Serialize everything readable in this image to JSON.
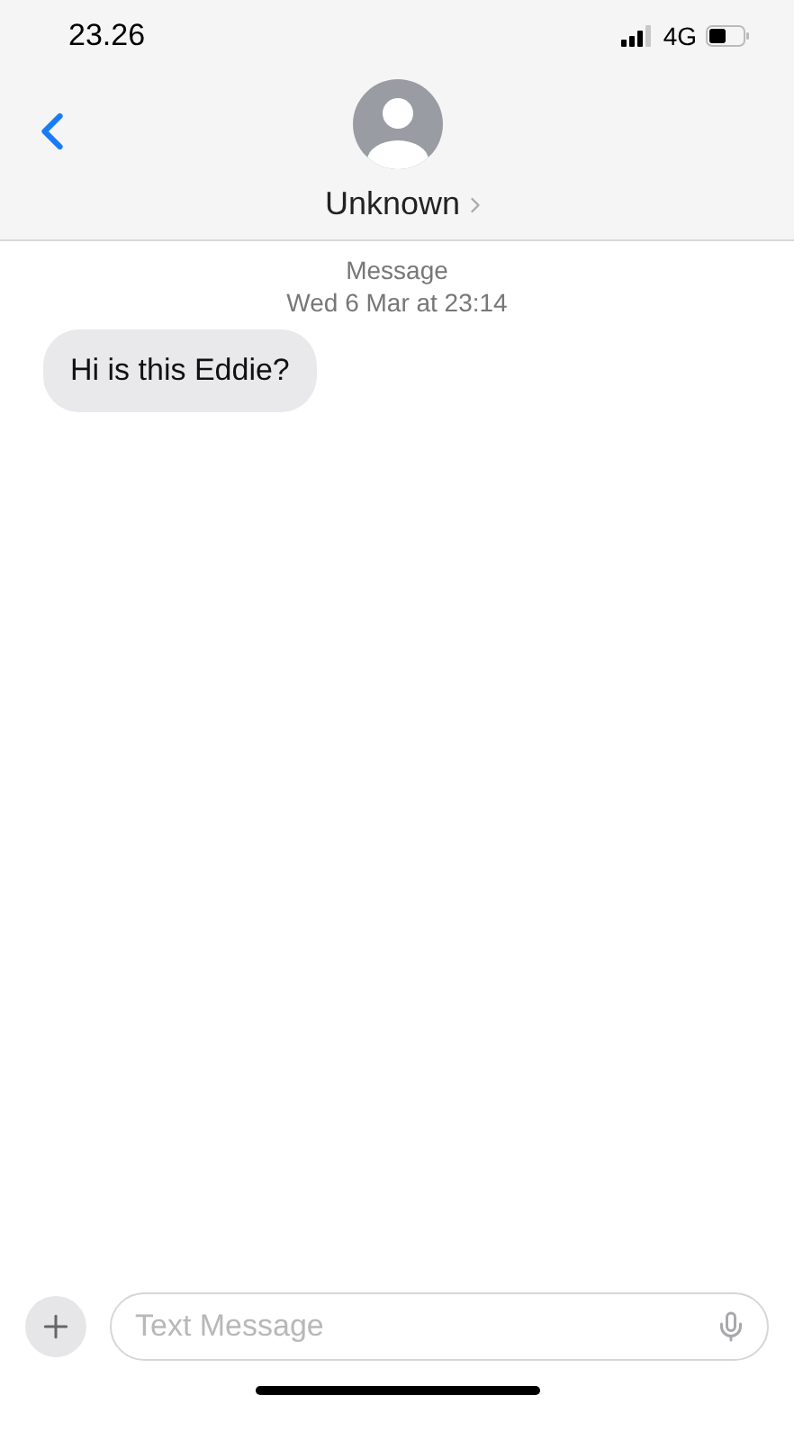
{
  "status_bar": {
    "time": "23.26",
    "network": "4G"
  },
  "header": {
    "contact_name": "Unknown"
  },
  "thread": {
    "service": "Message",
    "timestamp": "Wed 6 Mar at 23:14",
    "messages": [
      {
        "text": "Hi is this Eddie?",
        "kind": "incoming"
      }
    ]
  },
  "composer": {
    "placeholder": "Text Message"
  }
}
